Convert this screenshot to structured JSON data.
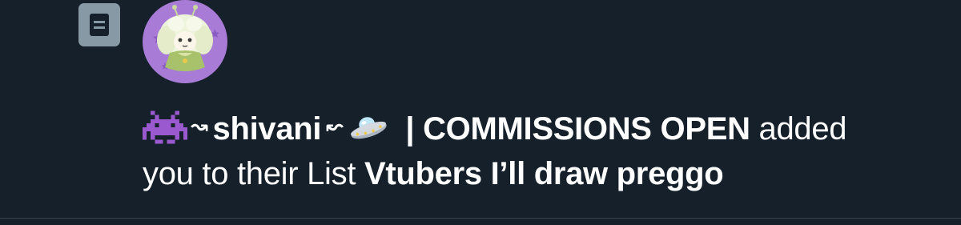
{
  "notification": {
    "list_icon": "list-icon",
    "avatar_icon": "avatar-image",
    "emoji_left": "alien-monster-icon",
    "emoji_right": "flying-saucer-icon",
    "arrow_right": "↝",
    "arrow_left": "↜",
    "user_name": "shivani",
    "separator_status": "| COMMISSIONS OPEN",
    "action_text": "added",
    "line2_text": "you to their List",
    "list_name": "Vtubers I’ll draw preggo"
  },
  "colors": {
    "background": "#15202b",
    "text": "#ffffff",
    "list_icon_bg": "#8899a6",
    "avatar_bg": "#a87bd6",
    "divider": "#38444d"
  }
}
